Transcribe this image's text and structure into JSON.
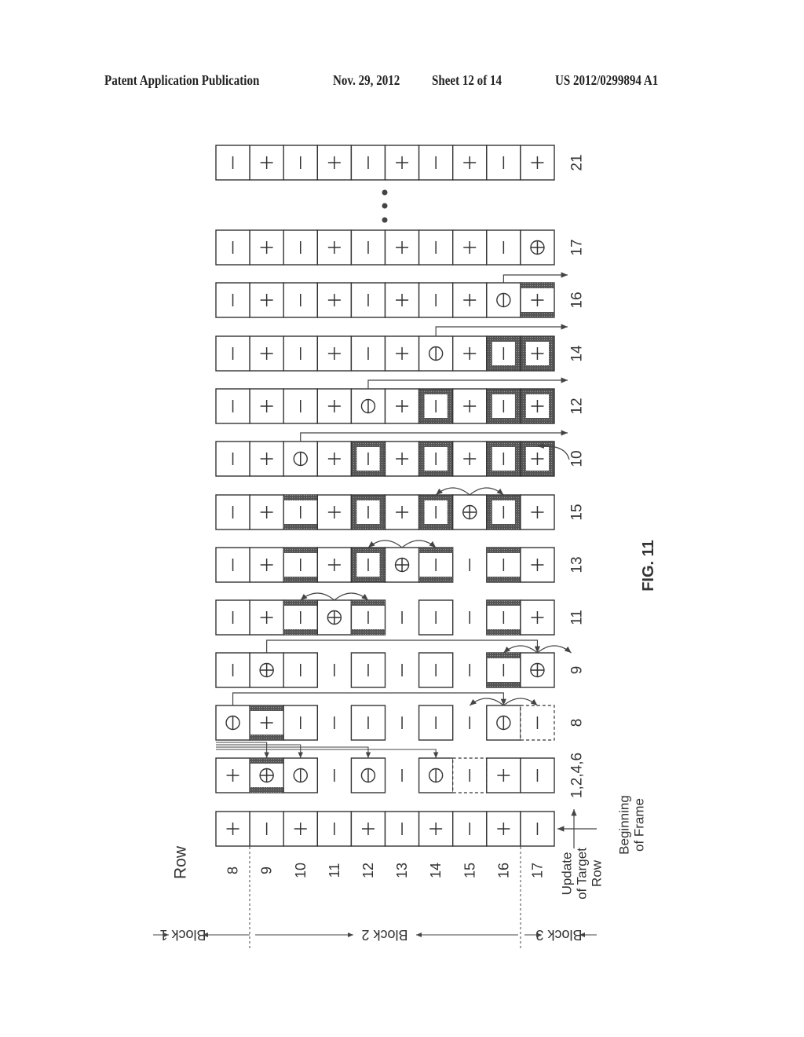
{
  "header": {
    "publication": "Patent Application Publication",
    "date": "Nov. 29, 2012",
    "sheet": "Sheet 12 of 14",
    "number": "US 2012/0299894 A1"
  },
  "figure": {
    "caption": "FIG. 11",
    "row_axis_title": "Row",
    "row_numbers": [
      "8",
      "9",
      "10",
      "11",
      "12",
      "13",
      "14",
      "15",
      "16",
      "17"
    ],
    "blocks": [
      "Block 1",
      "Block 2",
      "Block 3"
    ],
    "update_label": [
      "Update",
      "of Target",
      "Row"
    ],
    "beginning_label": [
      "Beginning",
      "of Frame"
    ],
    "ellipsis": "• • •",
    "strips": [
      {
        "label": "21",
        "cells": [
          [
            "-",
            "n"
          ],
          [
            "+",
            "n"
          ],
          [
            "-",
            "n"
          ],
          [
            "+",
            "n"
          ],
          [
            "-",
            "n"
          ],
          [
            "+",
            "n"
          ],
          [
            "-",
            "n"
          ],
          [
            "+",
            "n"
          ],
          [
            "-",
            "n"
          ],
          [
            "+",
            "n"
          ]
        ]
      },
      {
        "label": "17",
        "cells": [
          [
            "-",
            "n"
          ],
          [
            "+",
            "n"
          ],
          [
            "-",
            "n"
          ],
          [
            "+",
            "n"
          ],
          [
            "-",
            "n"
          ],
          [
            "+",
            "n"
          ],
          [
            "-",
            "n"
          ],
          [
            "+",
            "n"
          ],
          [
            "-",
            "n"
          ],
          [
            "(+)",
            "n"
          ]
        ]
      },
      {
        "label": "16",
        "cells": [
          [
            "-",
            "n"
          ],
          [
            "+",
            "n"
          ],
          [
            "-",
            "n"
          ],
          [
            "+",
            "n"
          ],
          [
            "-",
            "n"
          ],
          [
            "+",
            "n"
          ],
          [
            "-",
            "n"
          ],
          [
            "+",
            "n"
          ],
          [
            "(-)",
            "n"
          ],
          [
            "+",
            "tb"
          ]
        ]
      },
      {
        "label": "14",
        "cells": [
          [
            "-",
            "n"
          ],
          [
            "+",
            "n"
          ],
          [
            "-",
            "n"
          ],
          [
            "+",
            "n"
          ],
          [
            "-",
            "n"
          ],
          [
            "+",
            "n"
          ],
          [
            "(-)",
            "n"
          ],
          [
            "+",
            "n"
          ],
          [
            "-",
            "all"
          ],
          [
            "+",
            "all"
          ]
        ]
      },
      {
        "label": "12",
        "cells": [
          [
            "-",
            "n"
          ],
          [
            "+",
            "n"
          ],
          [
            "-",
            "n"
          ],
          [
            "+",
            "n"
          ],
          [
            "(-)",
            "n"
          ],
          [
            "+",
            "n"
          ],
          [
            "-",
            "all"
          ],
          [
            "+",
            "n"
          ],
          [
            "-",
            "all"
          ],
          [
            "+",
            "all"
          ]
        ]
      },
      {
        "label": "10",
        "cells": [
          [
            "-",
            "n"
          ],
          [
            "+",
            "n"
          ],
          [
            "(-)",
            "n"
          ],
          [
            "+",
            "n"
          ],
          [
            "-",
            "all"
          ],
          [
            "+",
            "n"
          ],
          [
            "-",
            "all"
          ],
          [
            "+",
            "n"
          ],
          [
            "-",
            "all"
          ],
          [
            "+",
            "all"
          ]
        ]
      },
      {
        "label": "15",
        "cells": [
          [
            "-",
            "n"
          ],
          [
            "+",
            "n"
          ],
          [
            "-",
            "tb"
          ],
          [
            "+",
            "n"
          ],
          [
            "-",
            "all"
          ],
          [
            "+",
            "n"
          ],
          [
            "-",
            "all"
          ],
          [
            "(+)",
            "n"
          ],
          [
            "-",
            "all"
          ],
          [
            "+",
            "n"
          ]
        ]
      },
      {
        "label": "13",
        "cells": [
          [
            "-",
            "n"
          ],
          [
            "+",
            "n"
          ],
          [
            "-",
            "tb"
          ],
          [
            "+",
            "n"
          ],
          [
            "-",
            "all"
          ],
          [
            "(+)",
            "n"
          ],
          [
            "-",
            "tb"
          ],
          [
            "-",
            "gap"
          ],
          [
            "-",
            "tb"
          ],
          [
            "+",
            "n"
          ]
        ]
      },
      {
        "label": "11",
        "cells": [
          [
            "-",
            "n"
          ],
          [
            "+",
            "n"
          ],
          [
            "-",
            "tb"
          ],
          [
            "(+)",
            "n"
          ],
          [
            "-",
            "tb"
          ],
          [
            "-",
            "gap"
          ],
          [
            "-",
            "n"
          ],
          [
            "-",
            "gap"
          ],
          [
            "-",
            "tb"
          ],
          [
            "+",
            "n"
          ]
        ]
      },
      {
        "label": "9",
        "cells": [
          [
            "-",
            "n"
          ],
          [
            "(+)",
            "n"
          ],
          [
            "-",
            "n"
          ],
          [
            "-",
            "gap"
          ],
          [
            "-",
            "n"
          ],
          [
            "-",
            "gap"
          ],
          [
            "-",
            "n"
          ],
          [
            "-",
            "gap"
          ],
          [
            "-",
            "tb"
          ],
          [
            "(+)",
            "n"
          ]
        ]
      },
      {
        "label": "8",
        "cells": [
          [
            "(-)",
            "n"
          ],
          [
            "+",
            "tb"
          ],
          [
            "-",
            "n"
          ],
          [
            "-",
            "gap"
          ],
          [
            "-",
            "n"
          ],
          [
            "-",
            "gap"
          ],
          [
            "-",
            "n"
          ],
          [
            "-",
            "gap"
          ],
          [
            "(-)",
            "n"
          ],
          [
            "-",
            "dashed"
          ]
        ]
      },
      {
        "label": "1,2,4,6",
        "cells": [
          [
            "+",
            "n"
          ],
          [
            "(+)",
            "tb"
          ],
          [
            "(-)",
            "n"
          ],
          [
            "-",
            "gap"
          ],
          [
            "(-)",
            "n"
          ],
          [
            "-",
            "gap"
          ],
          [
            "(-)",
            "n"
          ],
          [
            "-",
            "dashed"
          ],
          [
            "+",
            "n"
          ],
          [
            "-",
            "n"
          ]
        ]
      },
      {
        "label": "",
        "cells": [
          [
            "+",
            "n"
          ],
          [
            "-",
            "n"
          ],
          [
            "+",
            "n"
          ],
          [
            "-",
            "n"
          ],
          [
            "+",
            "n"
          ],
          [
            "-",
            "n"
          ],
          [
            "+",
            "n"
          ],
          [
            "-",
            "n"
          ],
          [
            "+",
            "n"
          ],
          [
            "-",
            "n"
          ]
        ]
      }
    ]
  }
}
